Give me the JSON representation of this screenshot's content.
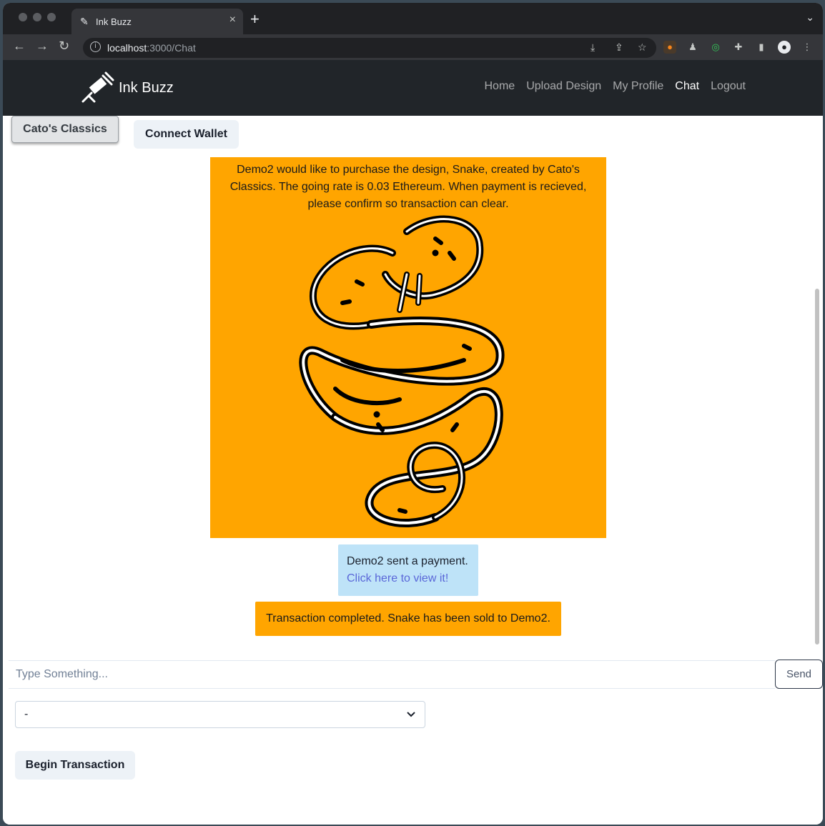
{
  "browser": {
    "tab_title": "Ink Buzz",
    "url_host": "localhost",
    "url_path": ":3000/Chat"
  },
  "navbar": {
    "brand": "Ink Buzz",
    "links": [
      "Home",
      "Upload Design",
      "My Profile",
      "Chat",
      "Logout"
    ],
    "active_link": "Chat"
  },
  "chat": {
    "contact_tab": "Cato's Classics",
    "connect_wallet": "Connect Wallet",
    "messages": {
      "request": "Demo2 would like to purchase the design, Snake, created by Cato's Classics. The going rate is 0.03 Ethereum. When payment is recieved, please confirm so transaction can clear.",
      "payment_text": "Demo2 sent a payment.",
      "payment_link": "Click here to view it!",
      "completed": "Transaction completed. Snake has been sold to Demo2."
    },
    "input_placeholder": "Type Something...",
    "send_label": "Send",
    "select_value": "-",
    "begin_transaction": "Begin Transaction"
  },
  "colors": {
    "navbar_bg": "#212529",
    "orange_message": "#ffa500",
    "payment_message": "#bee3f8",
    "link": "#5a67d8"
  }
}
